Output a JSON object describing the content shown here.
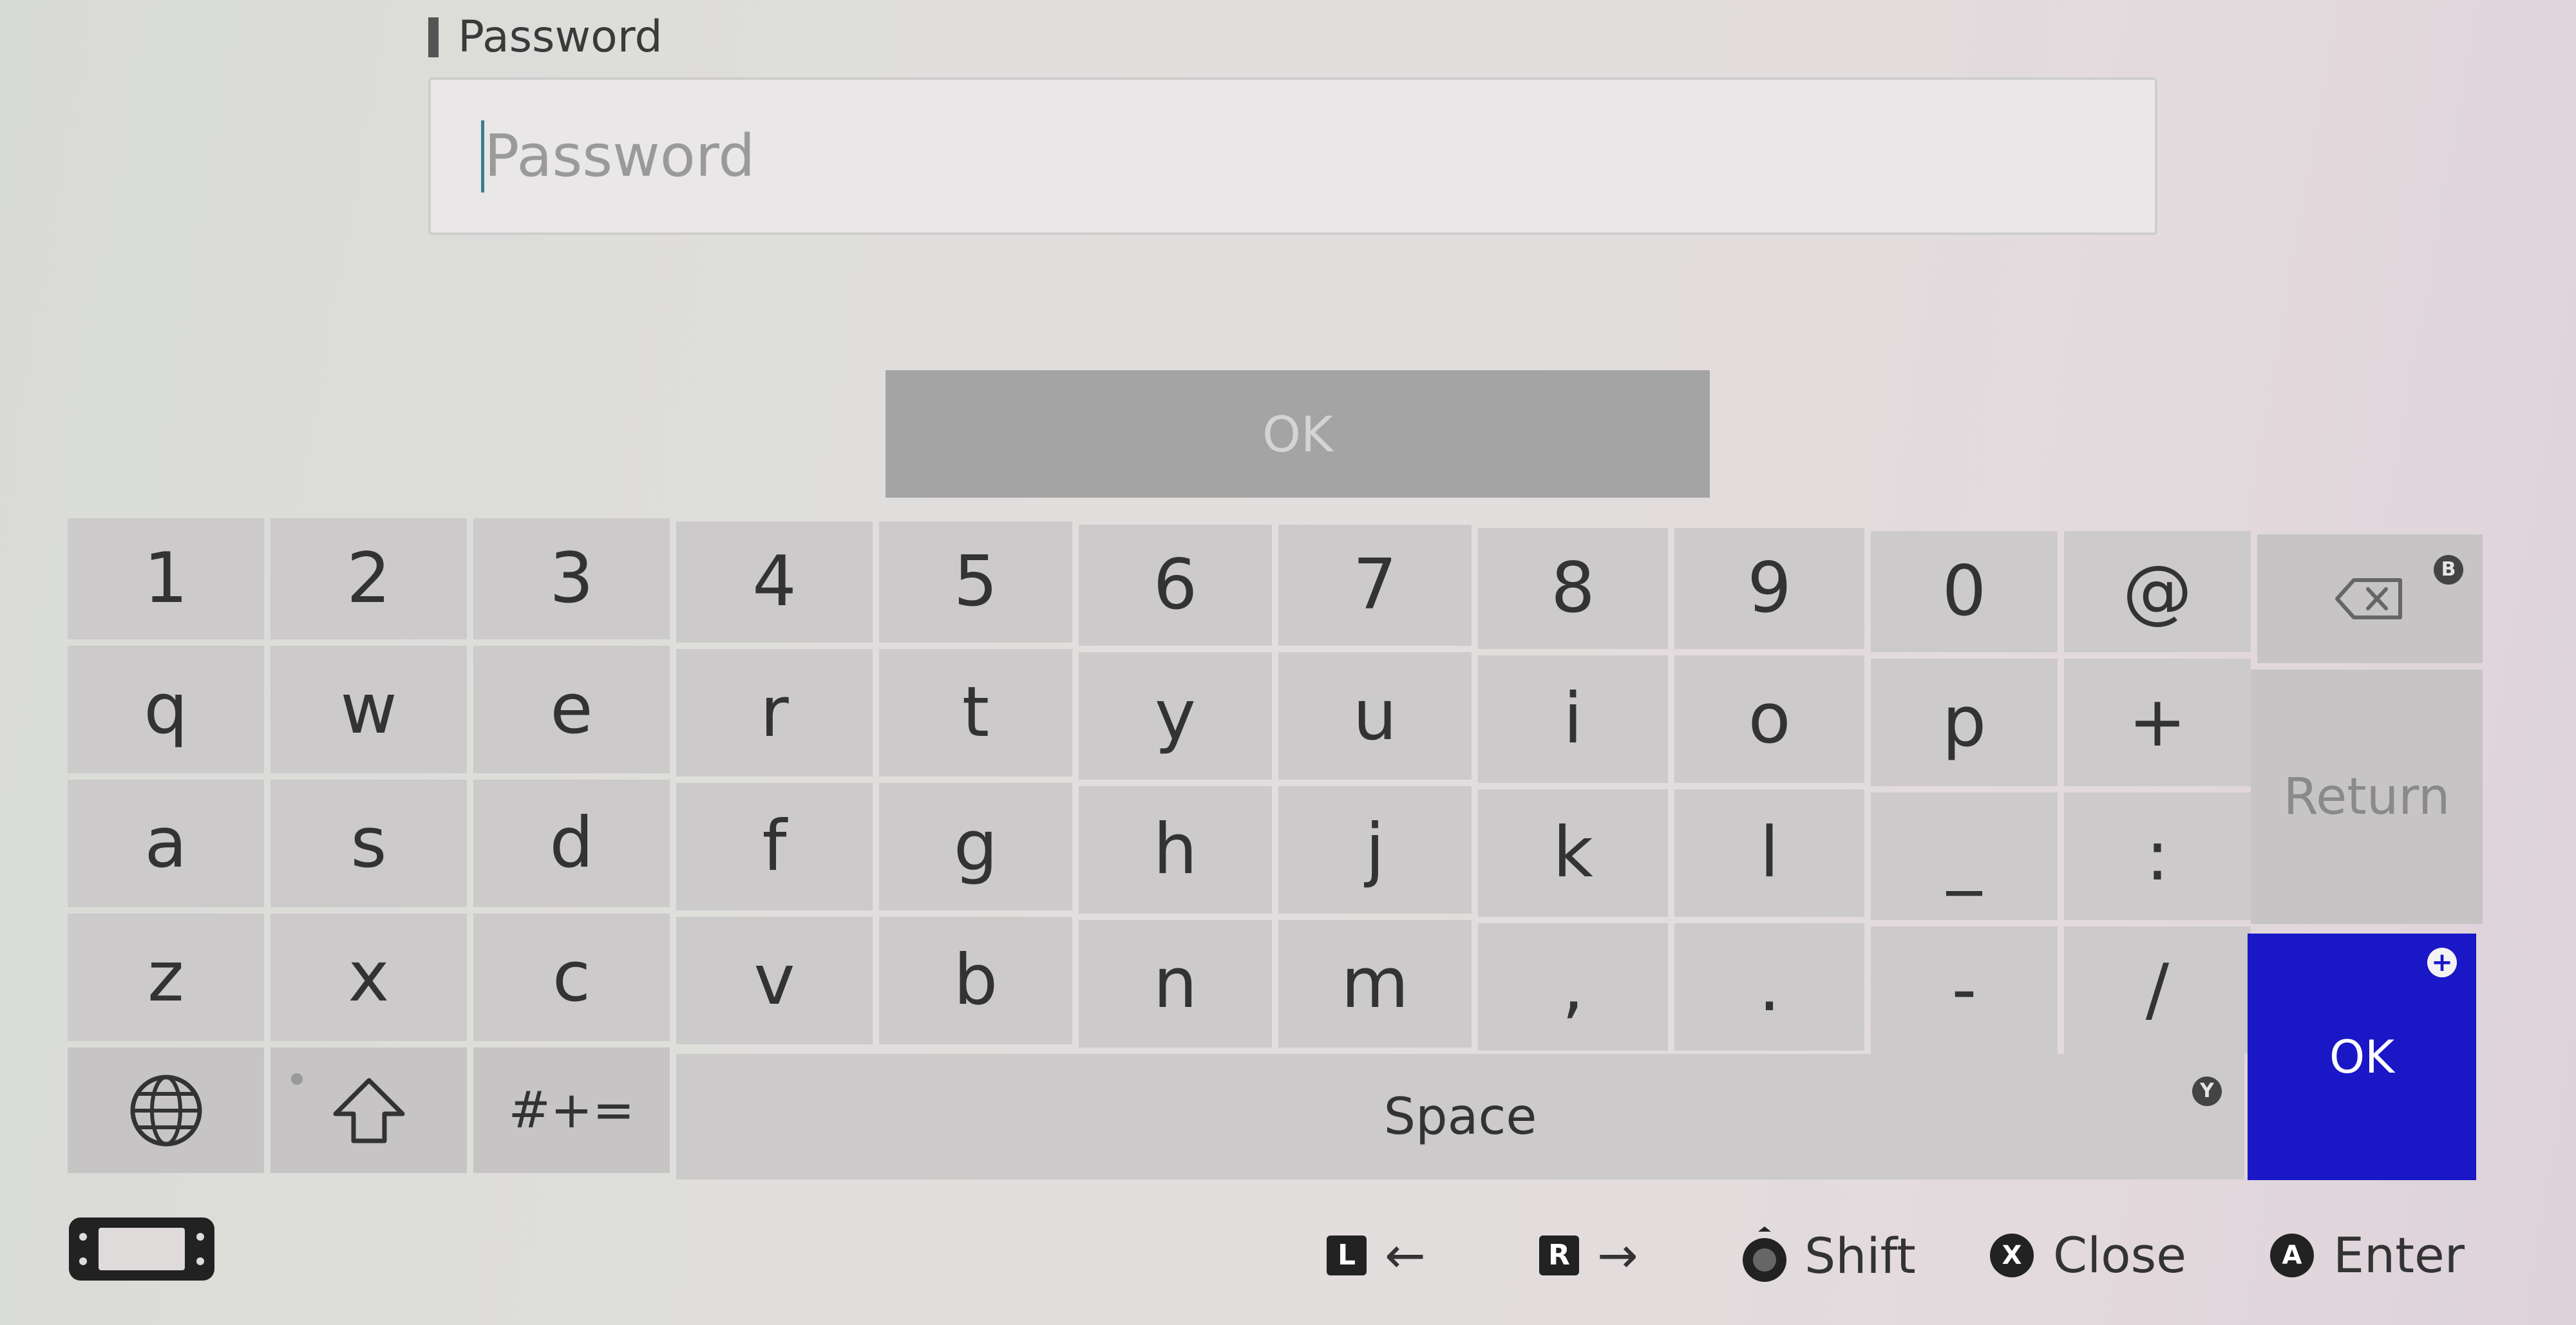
{
  "field": {
    "label": "Password",
    "placeholder": "Password"
  },
  "top_ok_label": "OK",
  "keyboard": {
    "row1": [
      "1",
      "2",
      "3",
      "4",
      "5",
      "6",
      "7",
      "8",
      "9",
      "0",
      "@"
    ],
    "row2": [
      "q",
      "w",
      "e",
      "r",
      "t",
      "y",
      "u",
      "i",
      "o",
      "p",
      "+"
    ],
    "row3": [
      "a",
      "s",
      "d",
      "f",
      "g",
      "h",
      "j",
      "k",
      "l",
      "_",
      ":"
    ],
    "row4": [
      "z",
      "x",
      "c",
      "v",
      "b",
      "n",
      "m",
      ",",
      ".",
      "-",
      "/"
    ],
    "backspace_badge": "B",
    "return_label": "Return",
    "ok_label": "OK",
    "ok_badge": "+",
    "symbols_label": "#+=",
    "space_label": "Space",
    "space_badge": "Y",
    "ok_color": "#1a17c7"
  },
  "footer": {
    "l_key": "L",
    "l_arrow": "←",
    "r_key": "R",
    "r_arrow": "→",
    "shift_label": "Shift",
    "x_key": "X",
    "close_label": "Close",
    "a_key": "A",
    "enter_label": "Enter"
  }
}
